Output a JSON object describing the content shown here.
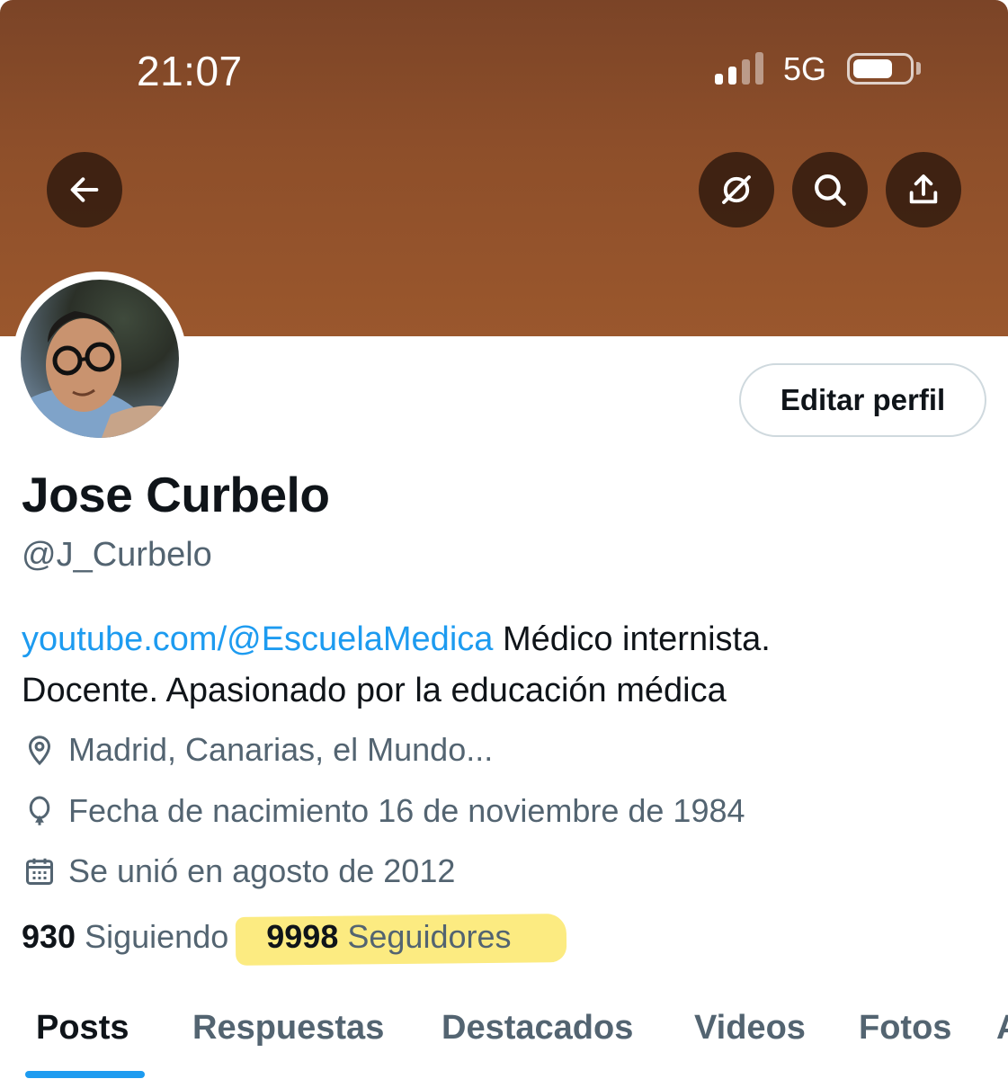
{
  "status_bar": {
    "time": "21:07",
    "network": "5G",
    "signal_bars_active": 2,
    "signal_bars_total": 4,
    "battery_level": 0.7
  },
  "header": {
    "banner_color": "#8e4f2a",
    "back_icon": "arrow-left-icon",
    "feed_icon": "no-feed-icon",
    "search_icon": "search-icon",
    "share_icon": "share-icon"
  },
  "profile": {
    "edit_label": "Editar perfil",
    "name": "Jose Curbelo",
    "handle": "@J_Curbelo",
    "bio_link": "youtube.com/@EscuelaMedica",
    "bio_text_1": " Médico internista.",
    "bio_text_2": "Docente. Apasionado por la educación médica",
    "location": "Madrid, Canarias, el Mundo...",
    "birthday": "Fecha de nacimiento 16 de noviembre de 1984",
    "joined": "Se unió en agosto de 2012"
  },
  "stats": {
    "following_count": "930",
    "following_label": "Siguiendo",
    "followers_count": "9998",
    "followers_label": "Seguidores"
  },
  "tabs": [
    {
      "label": "Posts",
      "active": true
    },
    {
      "label": "Respuestas",
      "active": false
    },
    {
      "label": "Destacados",
      "active": false
    },
    {
      "label": "Videos",
      "active": false
    },
    {
      "label": "Fotos",
      "active": false
    },
    {
      "label": "A",
      "active": false
    }
  ],
  "colors": {
    "accent": "#1d9bf0",
    "text_primary": "#0f1419",
    "text_secondary": "#536471",
    "highlight": "#fbe76b"
  }
}
